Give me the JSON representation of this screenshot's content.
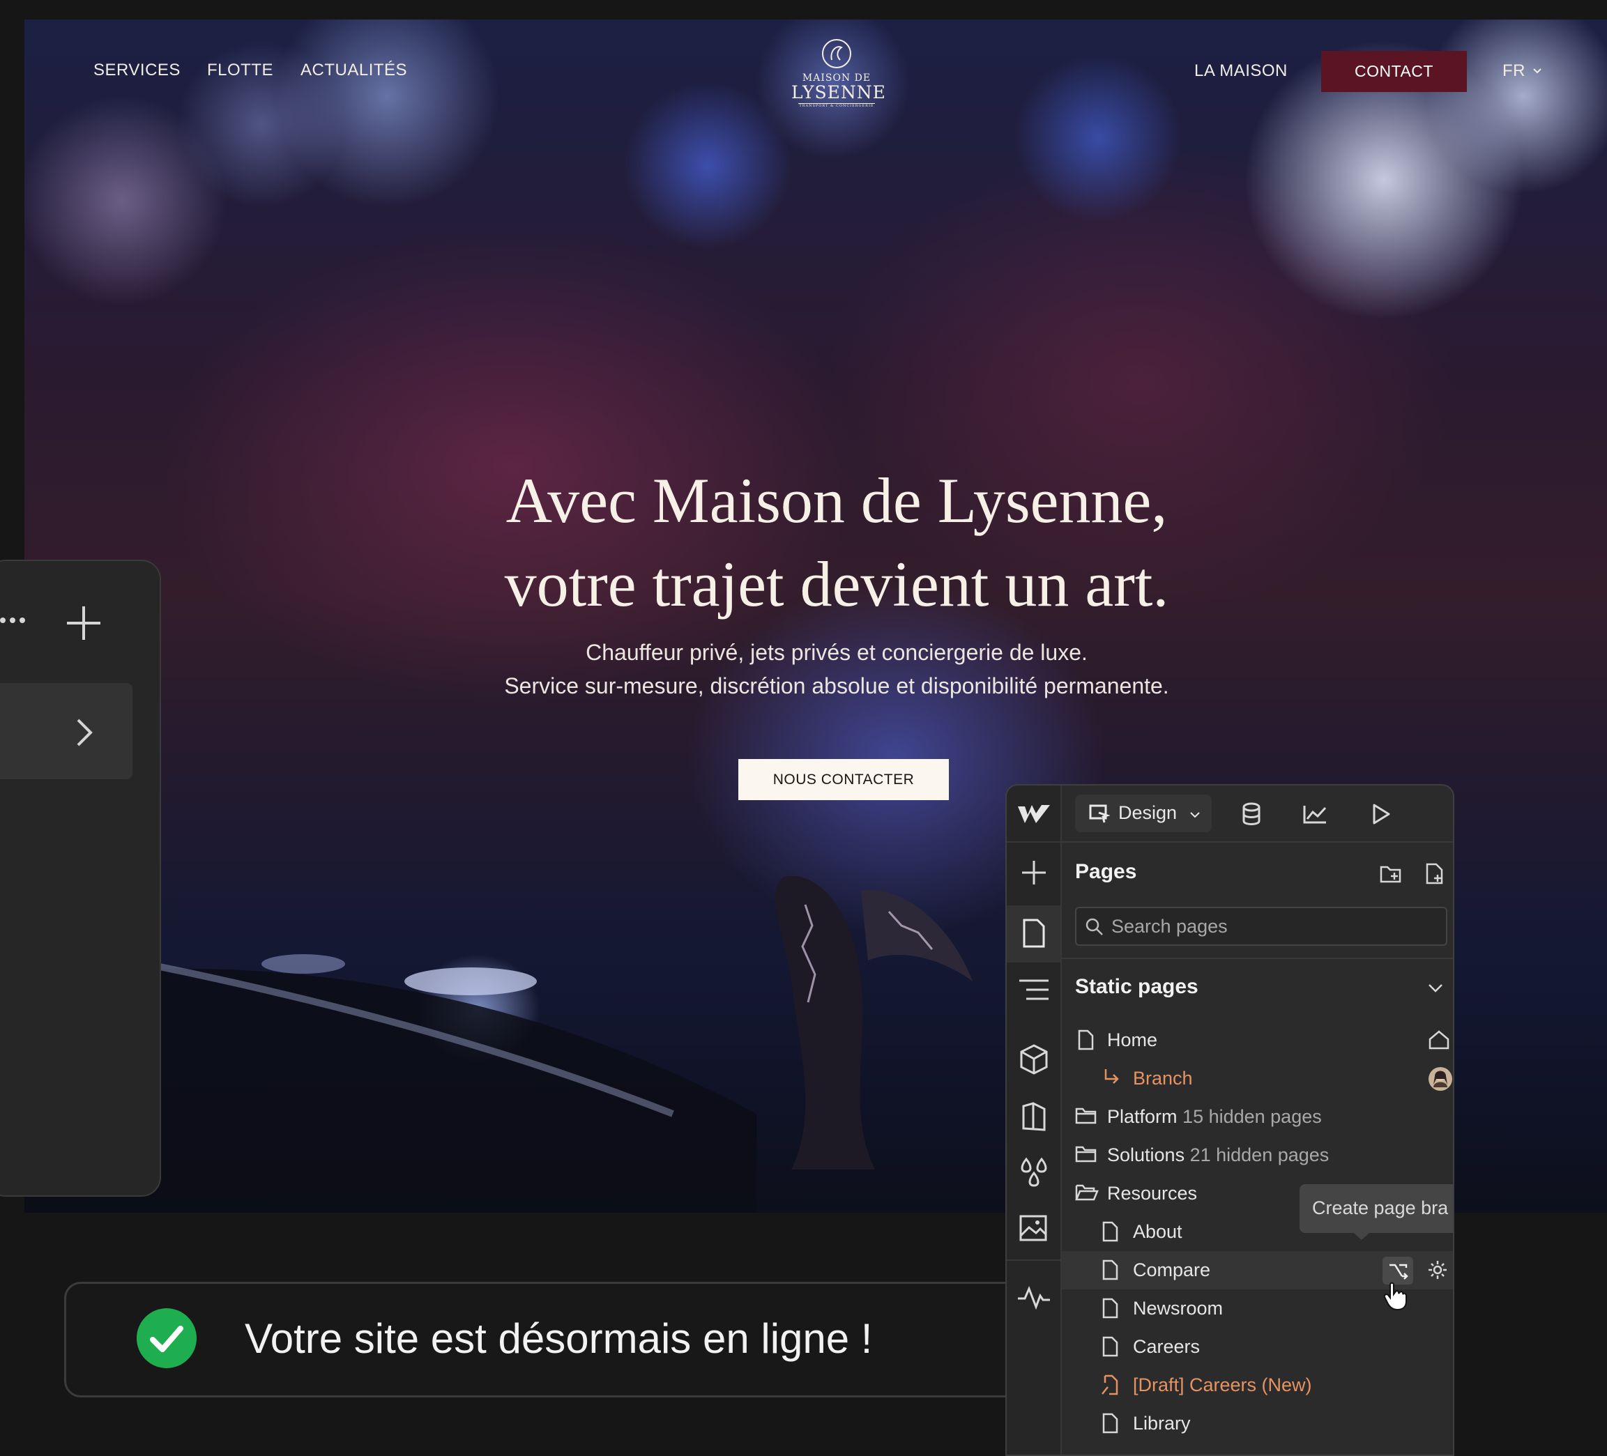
{
  "site": {
    "nav_left": [
      "SERVICES",
      "FLOTTE",
      "ACTUALITÉS"
    ],
    "nav_right": {
      "la_maison": "LA MAISON",
      "contact": "CONTACT",
      "language": "FR"
    },
    "logo": {
      "line1": "MAISON DE",
      "line2": "LYSENNE",
      "tagline": "TRANSPORT & CONCIERGERIE"
    },
    "hero": {
      "headline_line1": "Avec Maison de Lysenne,",
      "headline_line2": "votre trajet devient un art.",
      "sub_line1": "Chauffeur privé, jets privés et conciergerie de luxe.",
      "sub_line2": "Service sur-mesure, discrétion absolue et disponibilité permanente.",
      "cta": "NOUS CONTACTER"
    },
    "colors": {
      "contact_bg": "#5a1422",
      "cta_bg": "#fbf6ee"
    }
  },
  "toast": {
    "message": "Votre site est désormais en ligne !",
    "icon": "check-circle-icon",
    "icon_color": "#1fae4f"
  },
  "webflow": {
    "mode": "Design",
    "pages_title": "Pages",
    "search_placeholder": "Search pages",
    "section_title": "Static pages",
    "tooltip": "Create page bra",
    "accent_orange": "#e59363",
    "items": {
      "home": "Home",
      "branch": "Branch",
      "platform": "Platform",
      "platform_hint": "15 hidden pages",
      "solutions": "Solutions",
      "solutions_hint": "21 hidden pages",
      "resources": "Resources",
      "about": "About",
      "compare": "Compare",
      "newsroom": "Newsroom",
      "careers": "Careers",
      "draft_careers": "[Draft] Careers (New)",
      "library": "Library"
    }
  }
}
